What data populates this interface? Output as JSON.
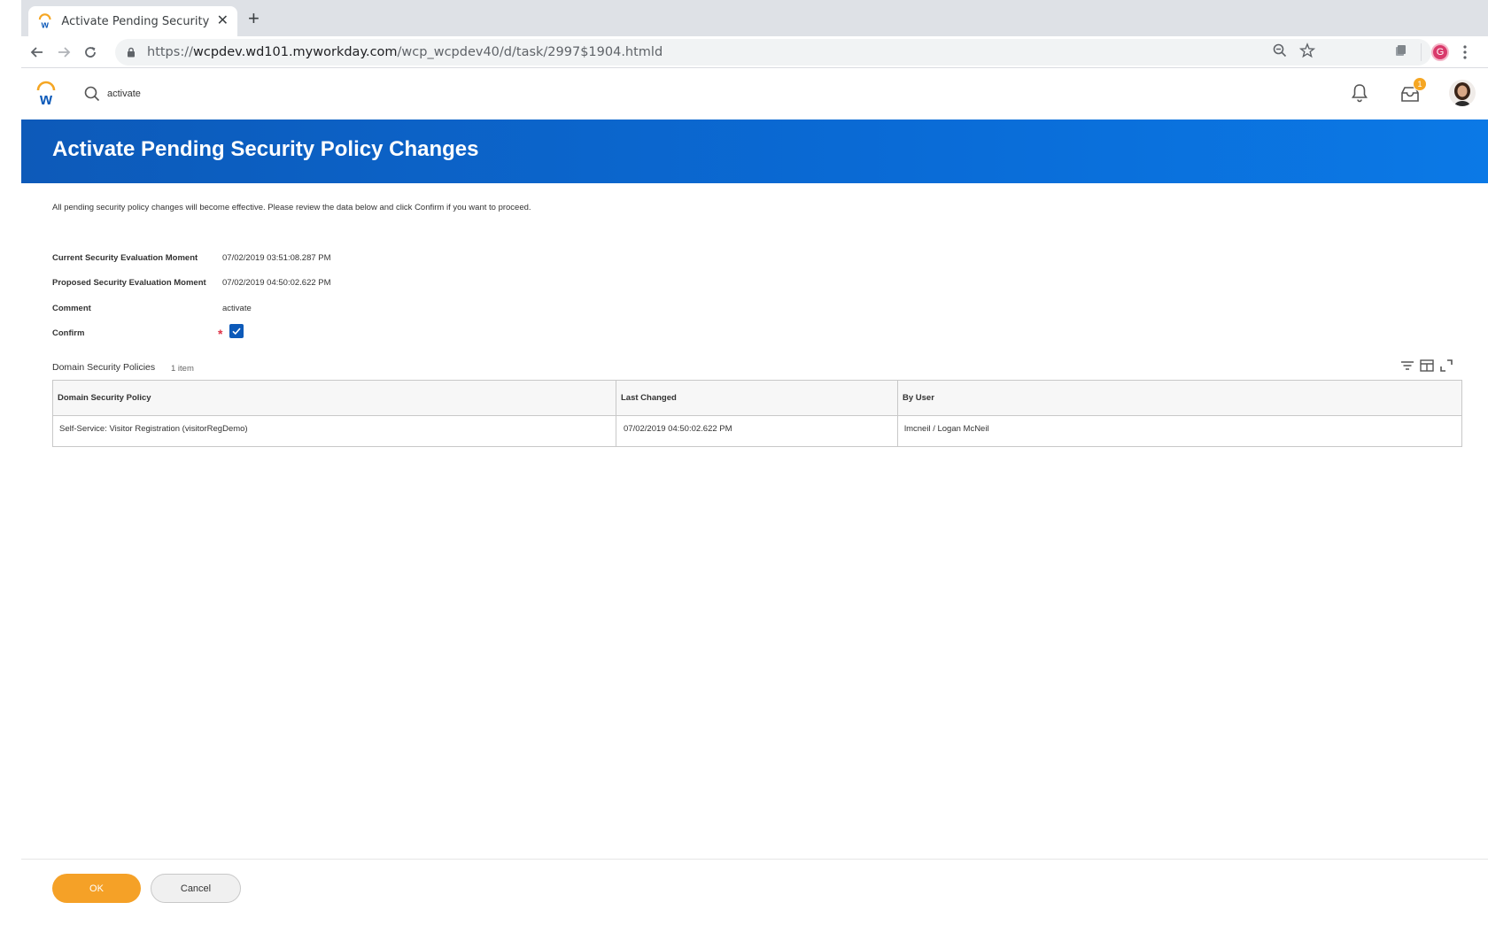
{
  "browser": {
    "tab_title": "Activate Pending Security Polic",
    "url_prefix": "https://",
    "url_host": "wcpdev.wd101.myworkday.com",
    "url_path": "/wcp_wcpdev40/d/task/2997$1904.htmld",
    "profile_initial": "G"
  },
  "header": {
    "search_value": "activate",
    "inbox_badge": "1"
  },
  "page": {
    "title": "Activate Pending Security Policy Changes",
    "instructions": "All pending security policy changes will become effective. Please review the data below and click Confirm if you want to proceed."
  },
  "fields": [
    {
      "label": "Current Security Evaluation Moment",
      "value": "07/02/2019 03:51:08.287 PM"
    },
    {
      "label": "Proposed Security Evaluation Moment",
      "value": "07/02/2019 04:50:02.622 PM"
    },
    {
      "label": "Comment",
      "value": "activate"
    },
    {
      "label": "Confirm",
      "value": ""
    }
  ],
  "confirm_checked": true,
  "grid": {
    "title": "Domain Security Policies",
    "count": "1 item",
    "columns": [
      "Domain Security Policy",
      "Last Changed",
      "By User"
    ],
    "rows": [
      [
        "Self-Service: Visitor Registration (visitorRegDemo)",
        "07/02/2019 04:50:02.622 PM",
        "lmcneil / Logan McNeil"
      ]
    ]
  },
  "footer": {
    "ok_label": "OK",
    "cancel_label": "Cancel"
  },
  "colors": {
    "brand_blue": "#0d5ab9",
    "ok_orange": "#f5a127",
    "required_red": "#de3448"
  }
}
